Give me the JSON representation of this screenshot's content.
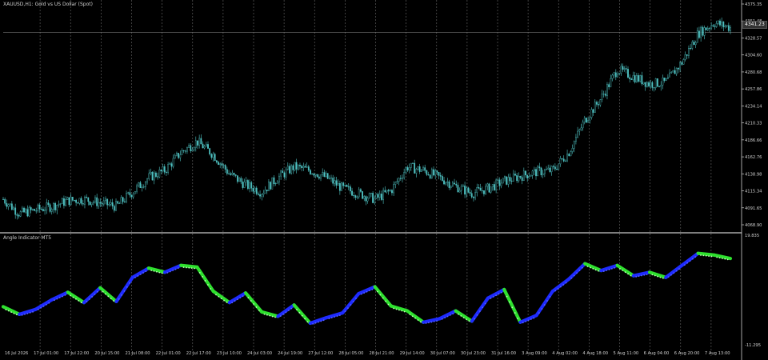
{
  "chart": {
    "title": "XAUUSD,H1: Gold vs US Dollar (Spot)",
    "current_price": "4341.23",
    "price_ticks": [
      "4375.35",
      "4351.48",
      "4328.57",
      "4304.60",
      "4280.68",
      "4257.86",
      "4234.14",
      "4210.33",
      "4186.66",
      "4162.76",
      "4138.98",
      "4115.34",
      "4091.65",
      "4068.90"
    ],
    "time_ticks": [
      "16 Jul 2026",
      "17 Jul 01:00",
      "17 Jul 22:00",
      "20 Jul 15:00",
      "21 Jul 08:00",
      "22 Jul 01:00",
      "22 Jul 17:00",
      "23 Jul 10:00",
      "24 Jul 03:00",
      "24 Jul 19:00",
      "27 Jul 12:00",
      "28 Jul 05:00",
      "28 Jul 21:00",
      "29 Jul 14:00",
      "30 Jul 07:00",
      "30 Jul 23:00",
      "31 Jul 16:00",
      "3 Aug 09:00",
      "4 Aug 02:00",
      "4 Aug 18:00",
      "5 Aug 11:00",
      "6 Aug 04:00",
      "6 Aug 20:00",
      "7 Aug 13:00"
    ]
  },
  "indicator": {
    "title": "Angle Indicator MT5",
    "scale_top": "19.835",
    "scale_bottom": "-11.295"
  },
  "colors": {
    "background": "#000000",
    "candle": "#4fc3c3",
    "grid": "#5a5a5a",
    "up_segment": "#1e2bff",
    "down_segment": "#2ee02e",
    "separator": "#c8c8c8"
  },
  "chart_data": {
    "type": "line",
    "price_series": [
      {
        "t": 0,
        "p": 4110
      },
      {
        "t": 1,
        "p": 4090
      },
      {
        "t": 2,
        "p": 4095
      },
      {
        "t": 3,
        "p": 4100
      },
      {
        "t": 4,
        "p": 4108
      },
      {
        "t": 5,
        "p": 4110
      },
      {
        "t": 6,
        "p": 4105
      },
      {
        "t": 7,
        "p": 4100
      },
      {
        "t": 8,
        "p": 4120
      },
      {
        "t": 9,
        "p": 4140
      },
      {
        "t": 10,
        "p": 4150
      },
      {
        "t": 11,
        "p": 4175
      },
      {
        "t": 12,
        "p": 4190
      },
      {
        "t": 13,
        "p": 4172
      },
      {
        "t": 14,
        "p": 4145
      },
      {
        "t": 15,
        "p": 4130
      },
      {
        "t": 16,
        "p": 4120
      },
      {
        "t": 17,
        "p": 4140
      },
      {
        "t": 18,
        "p": 4155
      },
      {
        "t": 19,
        "p": 4150
      },
      {
        "t": 20,
        "p": 4140
      },
      {
        "t": 21,
        "p": 4125
      },
      {
        "t": 22,
        "p": 4118
      },
      {
        "t": 23,
        "p": 4110
      },
      {
        "t": 24,
        "p": 4122
      },
      {
        "t": 25,
        "p": 4155
      },
      {
        "t": 26,
        "p": 4150
      },
      {
        "t": 27,
        "p": 4140
      },
      {
        "t": 28,
        "p": 4128
      },
      {
        "t": 29,
        "p": 4118
      },
      {
        "t": 30,
        "p": 4125
      },
      {
        "t": 31,
        "p": 4135
      },
      {
        "t": 32,
        "p": 4142
      },
      {
        "t": 33,
        "p": 4148
      },
      {
        "t": 34,
        "p": 4150
      },
      {
        "t": 35,
        "p": 4175
      },
      {
        "t": 36,
        "p": 4220
      },
      {
        "t": 37,
        "p": 4250
      },
      {
        "t": 38,
        "p": 4290
      },
      {
        "t": 39,
        "p": 4280
      },
      {
        "t": 40,
        "p": 4270
      },
      {
        "t": 41,
        "p": 4272
      },
      {
        "t": 42,
        "p": 4300
      },
      {
        "t": 43,
        "p": 4340
      },
      {
        "t": 44,
        "p": 4355
      },
      {
        "t": 45,
        "p": 4348
      }
    ],
    "indicator_series": [
      {
        "t": 0,
        "v": 0
      },
      {
        "t": 1,
        "v": -2.2
      },
      {
        "t": 2,
        "v": -0.8
      },
      {
        "t": 3,
        "v": 2.0
      },
      {
        "t": 4,
        "v": 4.2
      },
      {
        "t": 5,
        "v": 1.2
      },
      {
        "t": 6,
        "v": 5.5
      },
      {
        "t": 7,
        "v": 1.5
      },
      {
        "t": 8,
        "v": 8.5
      },
      {
        "t": 9,
        "v": 11.2
      },
      {
        "t": 10,
        "v": 10.0
      },
      {
        "t": 11,
        "v": 12.0
      },
      {
        "t": 12,
        "v": 11.5
      },
      {
        "t": 13,
        "v": 4.5
      },
      {
        "t": 14,
        "v": 1.2
      },
      {
        "t": 15,
        "v": 4.0
      },
      {
        "t": 16,
        "v": -1.5
      },
      {
        "t": 17,
        "v": -2.8
      },
      {
        "t": 18,
        "v": 0.5
      },
      {
        "t": 19,
        "v": -4.8
      },
      {
        "t": 20,
        "v": -3.2
      },
      {
        "t": 21,
        "v": -1.8
      },
      {
        "t": 22,
        "v": 3.8
      },
      {
        "t": 23,
        "v": 5.8
      },
      {
        "t": 24,
        "v": 0.2
      },
      {
        "t": 25,
        "v": -1.2
      },
      {
        "t": 26,
        "v": -4.5
      },
      {
        "t": 27,
        "v": -3.5
      },
      {
        "t": 28,
        "v": -1.2
      },
      {
        "t": 29,
        "v": -4.2
      },
      {
        "t": 30,
        "v": 2.5
      },
      {
        "t": 31,
        "v": 5.0
      },
      {
        "t": 32,
        "v": -4.5
      },
      {
        "t": 33,
        "v": -2.5
      },
      {
        "t": 34,
        "v": 4.5
      },
      {
        "t": 35,
        "v": 8.0
      },
      {
        "t": 36,
        "v": 12.5
      },
      {
        "t": 37,
        "v": 10.5
      },
      {
        "t": 38,
        "v": 12.0
      },
      {
        "t": 39,
        "v": 9.0
      },
      {
        "t": 40,
        "v": 10.0
      },
      {
        "t": 41,
        "v": 8.5
      },
      {
        "t": 42,
        "v": 12.0
      },
      {
        "t": 43,
        "v": 15.5
      },
      {
        "t": 44,
        "v": 15.0
      },
      {
        "t": 45,
        "v": 14.0
      }
    ],
    "ylim_price": [
      4068.9,
      4375.35
    ],
    "ylim_indicator": [
      -11.295,
      19.835
    ],
    "grid": true
  }
}
